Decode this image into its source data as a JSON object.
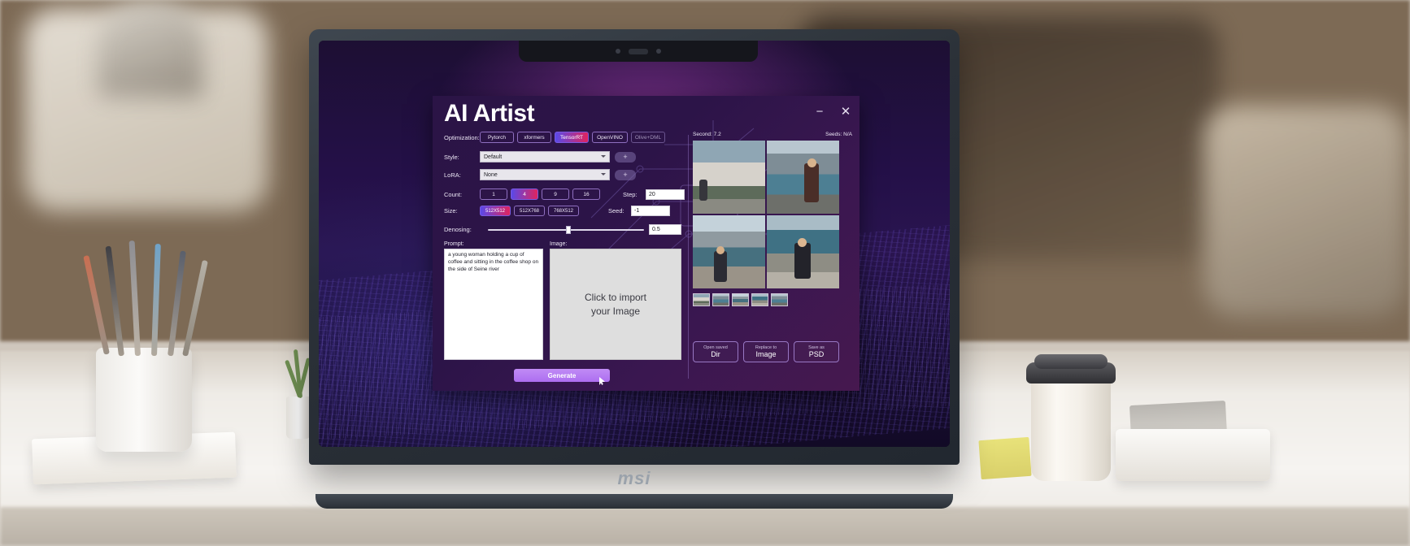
{
  "scene": {
    "laptop_brand": "msi"
  },
  "app": {
    "title": "AI Artist",
    "window_controls": {
      "minimize": "−",
      "close": "✕"
    },
    "optimization": {
      "label": "Optimization:",
      "options": [
        {
          "label": "Pytorch",
          "state": "normal"
        },
        {
          "label": "xformers",
          "state": "normal"
        },
        {
          "label": "TensorRT",
          "state": "active"
        },
        {
          "label": "OpenVINO",
          "state": "normal"
        },
        {
          "label": "Olive+DML",
          "state": "disabled"
        }
      ]
    },
    "style": {
      "label": "Style:",
      "value": "Default",
      "add_button": "+"
    },
    "lora": {
      "label": "LoRA:",
      "value": "None",
      "add_button": "+"
    },
    "count": {
      "label": "Count:",
      "options": [
        {
          "label": "1",
          "state": "normal"
        },
        {
          "label": "4",
          "state": "active"
        },
        {
          "label": "9",
          "state": "normal"
        },
        {
          "label": "16",
          "state": "normal"
        }
      ]
    },
    "size": {
      "label": "Size:",
      "options": [
        {
          "label": "512X512",
          "state": "active"
        },
        {
          "label": "512X768",
          "state": "normal"
        },
        {
          "label": "768X512",
          "state": "normal"
        }
      ]
    },
    "step": {
      "label": "Step:",
      "value": "20"
    },
    "seed": {
      "label": "Seed:",
      "value": "-1"
    },
    "denoising": {
      "label": "Denosing:",
      "value": "0.5",
      "slider_percent": 50
    },
    "prompt": {
      "label": "Prompt:",
      "value": "a young woman holding a cup of coffee and sitting in the coffee shop on the side of Seine river"
    },
    "image_drop": {
      "label": "Image:",
      "placeholder_line1": "Click to import",
      "placeholder_line2": "your Image"
    },
    "generate_button": "Generate",
    "results": {
      "second_label": "Second: 7.2",
      "seeds_label": "Seeds: N/A",
      "thumbnail_count": 5
    },
    "actions": [
      {
        "top": "Open saved",
        "bottom": "Dir"
      },
      {
        "top": "Replace to",
        "bottom": "Image"
      },
      {
        "top": "Save as",
        "bottom": "PSD"
      }
    ],
    "colors": {
      "accent_gradient_start": "#5a49e8",
      "accent_gradient_end": "#e0245e",
      "generate_button": "#ad6ef0",
      "window_bg": "#2c1448"
    }
  }
}
